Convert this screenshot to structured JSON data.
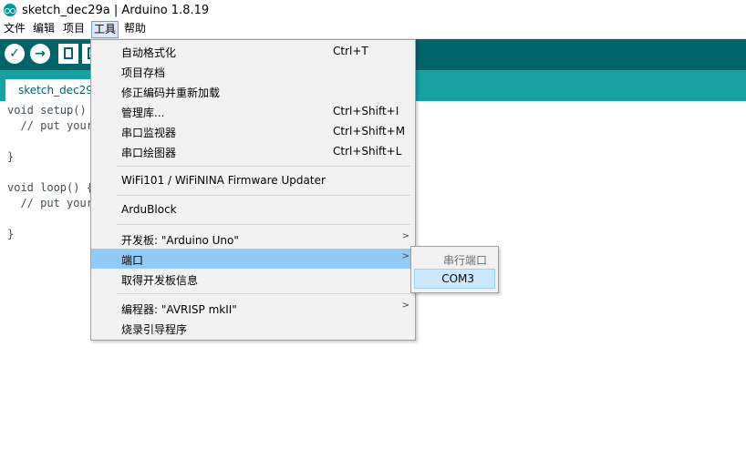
{
  "window": {
    "title": "sketch_dec29a | Arduino 1.8.19"
  },
  "menubar": {
    "items": [
      "文件",
      "编辑",
      "项目",
      "工具",
      "帮助"
    ]
  },
  "tabs": {
    "active_label": "sketch_dec29a"
  },
  "editor": {
    "lines": [
      "void setup() {",
      "  // put your",
      "",
      "}",
      "",
      "void loop() {",
      "  // put your",
      "",
      "}"
    ]
  },
  "tools_menu": {
    "items": [
      {
        "label": "自动格式化",
        "shortcut": "Ctrl+T"
      },
      {
        "label": "项目存档",
        "shortcut": ""
      },
      {
        "label": "修正编码并重新加载",
        "shortcut": ""
      },
      {
        "label": "管理库...",
        "shortcut": "Ctrl+Shift+I"
      },
      {
        "label": "串口监视器",
        "shortcut": "Ctrl+Shift+M"
      },
      {
        "label": "串口绘图器",
        "shortcut": "Ctrl+Shift+L"
      },
      {
        "label": "WiFi101 / WiFiNINA Firmware Updater",
        "shortcut": ""
      },
      {
        "label": "ArduBlock",
        "shortcut": ""
      },
      {
        "label": "开发板: \"Arduino Uno\"",
        "shortcut": ""
      },
      {
        "label": "端口",
        "shortcut": ""
      },
      {
        "label": "取得开发板信息",
        "shortcut": ""
      },
      {
        "label": "编程器: \"AVRISP mkII\"",
        "shortcut": ""
      },
      {
        "label": "烧录引导程序",
        "shortcut": ""
      }
    ]
  },
  "port_submenu": {
    "header": "串行端口",
    "items": [
      "COM3"
    ],
    "selected": "COM3"
  },
  "colors": {
    "toolbar": "#006468",
    "tabbar": "#17a1a5",
    "menu_highlight": "#91c9f7",
    "submenu_selected": "#cce8ff"
  }
}
